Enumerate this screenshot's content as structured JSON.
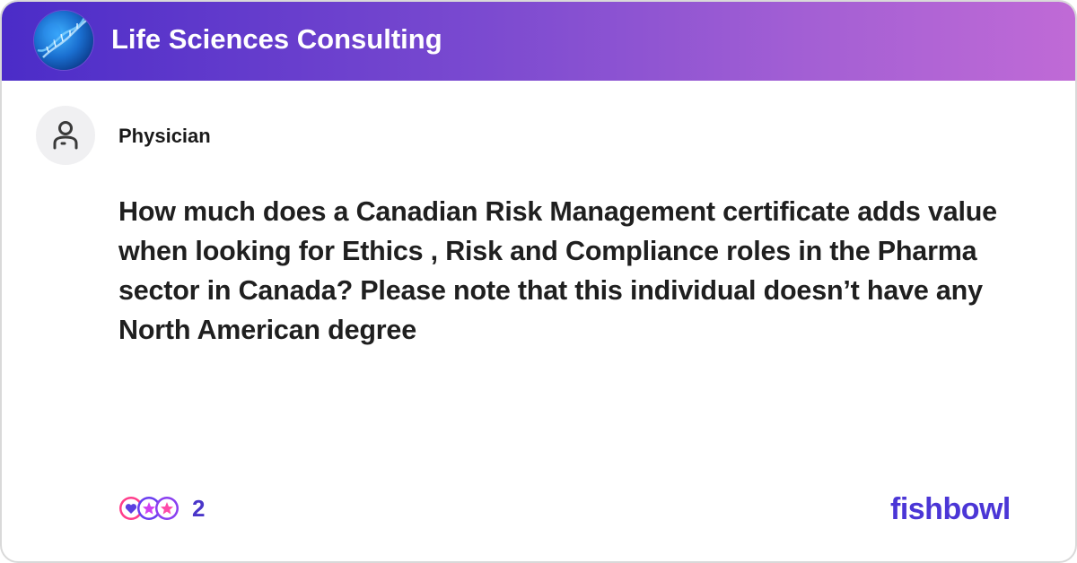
{
  "header": {
    "bowl_title": "Life Sciences Consulting",
    "avatar_icon": "dna-helix-image"
  },
  "post": {
    "author_role": "Physician",
    "author_icon": "user-icon",
    "question": "How much does a Canadian Risk Management certificate adds value when looking for Ethics , Risk and Compliance roles in the Pharma sector in Canada? Please note that this individual doesn’t have any North American degree"
  },
  "footer": {
    "reaction_icons": [
      "heart-reaction-icon",
      "star-reaction-icon",
      "star-reaction-icon"
    ],
    "reaction_count": "2",
    "brand": "fishbowl"
  },
  "colors": {
    "header_gradient_start": "#4b2cc8",
    "header_gradient_end": "#c06ad6",
    "brand": "#4b36d6",
    "count": "#4a36c9"
  }
}
